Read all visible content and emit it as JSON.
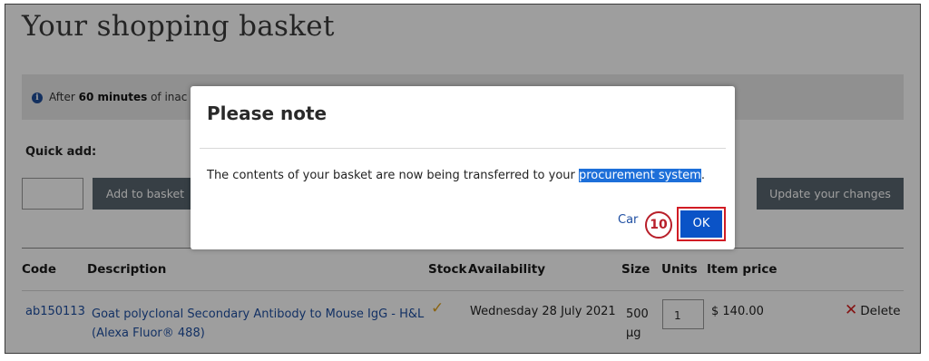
{
  "page": {
    "title": "Your shopping basket",
    "info_banner": {
      "prefix": "After ",
      "bold": "60 minutes",
      "suffix": " of inac"
    },
    "quick_add": {
      "label": "Quick add:",
      "add_button": "Add to basket"
    },
    "update_button": "Update your changes",
    "table": {
      "headers": {
        "code": "Code",
        "description": "Description",
        "stock": "Stock",
        "availability": "Availability",
        "size": "Size",
        "units": "Units",
        "price": "Item price"
      },
      "rows": [
        {
          "code": "ab150113",
          "description": "Goat polyclonal Secondary Antibody to Mouse IgG - H&L (Alexa Fluor® 488)",
          "stock_icon": "checkmark-icon",
          "availability": "Wednesday 28 July 2021",
          "size": "500 µg",
          "units": "1",
          "price": "$ 140.00",
          "delete_label": "Delete"
        }
      ]
    }
  },
  "modal": {
    "title": "Please note",
    "body_prefix": "The contents of your basket are now being transferred to your ",
    "body_highlight": "procurement system",
    "body_suffix": ".",
    "cancel_label": "Car",
    "step_number": "10",
    "ok_label": "OK"
  },
  "colors": {
    "link": "#1f4fa2",
    "button_dark": "#5a6670",
    "ok_blue": "#0a53c7",
    "annotation_red": "#d11c24",
    "check_orange": "#e0a21c"
  }
}
